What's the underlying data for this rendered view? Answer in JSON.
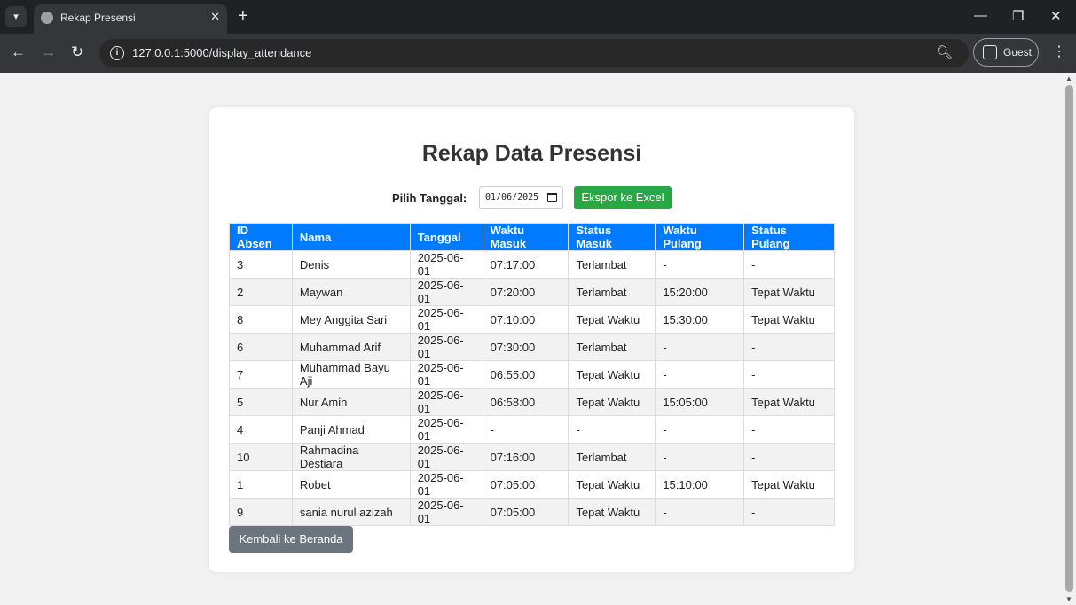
{
  "browser": {
    "tab_title": "Rekap Presensi",
    "url": "127.0.0.1:5000/display_attendance",
    "profile_label": "Guest"
  },
  "page": {
    "title": "Rekap Data Presensi",
    "date_label": "Pilih Tanggal:",
    "date_value": "01/06/2025",
    "export_label": "Ekspor ke Excel",
    "back_label": "Kembali ke Beranda"
  },
  "table": {
    "headers": [
      "ID Absen",
      "Nama",
      "Tanggal",
      "Waktu Masuk",
      "Status Masuk",
      "Waktu Pulang",
      "Status Pulang"
    ],
    "rows": [
      [
        "3",
        "Denis",
        "2025-06-01",
        "07:17:00",
        "Terlambat",
        "-",
        "-"
      ],
      [
        "2",
        "Maywan",
        "2025-06-01",
        "07:20:00",
        "Terlambat",
        "15:20:00",
        "Tepat Waktu"
      ],
      [
        "8",
        "Mey Anggita Sari",
        "2025-06-01",
        "07:10:00",
        "Tepat Waktu",
        "15:30:00",
        "Tepat Waktu"
      ],
      [
        "6",
        "Muhammad Arif",
        "2025-06-01",
        "07:30:00",
        "Terlambat",
        "-",
        "-"
      ],
      [
        "7",
        "Muhammad Bayu Aji",
        "2025-06-01",
        "06:55:00",
        "Tepat Waktu",
        "-",
        "-"
      ],
      [
        "5",
        "Nur Amin",
        "2025-06-01",
        "06:58:00",
        "Tepat Waktu",
        "15:05:00",
        "Tepat Waktu"
      ],
      [
        "4",
        "Panji Ahmad",
        "2025-06-01",
        "-",
        "-",
        "-",
        "-"
      ],
      [
        "10",
        "Rahmadina Destiara",
        "2025-06-01",
        "07:16:00",
        "Terlambat",
        "-",
        "-"
      ],
      [
        "1",
        "Robet",
        "2025-06-01",
        "07:05:00",
        "Tepat Waktu",
        "15:10:00",
        "Tepat Waktu"
      ],
      [
        "9",
        "sania nurul azizah",
        "2025-06-01",
        "07:05:00",
        "Tepat Waktu",
        "-",
        "-"
      ]
    ]
  },
  "colors": {
    "header_blue": "#007bff",
    "export_green": "#28a745",
    "back_gray": "#6c757d"
  }
}
